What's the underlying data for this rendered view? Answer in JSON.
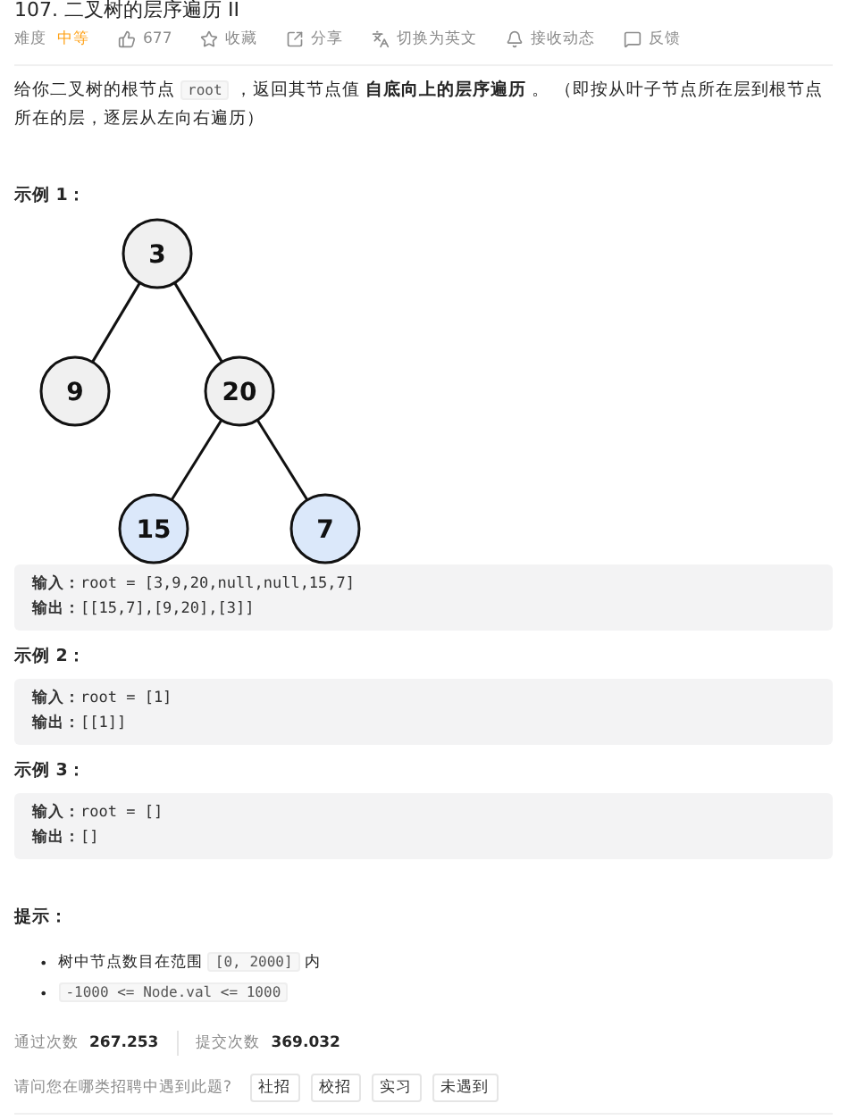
{
  "title": "107. 二叉树的层序遍历 II",
  "toolbar": {
    "difficulty_label": "难度",
    "difficulty": "中等",
    "items": [
      {
        "kind": "like",
        "label": "677"
      },
      {
        "kind": "star",
        "label": "收藏"
      },
      {
        "kind": "share",
        "label": "分享"
      },
      {
        "kind": "translate",
        "label": "切换为英文"
      },
      {
        "kind": "bell",
        "label": "接收动态"
      },
      {
        "kind": "feedback",
        "label": "反馈"
      }
    ]
  },
  "description": [
    {
      "kind": "text",
      "text": "给你二叉树的根节点 "
    },
    {
      "kind": "code",
      "text": "root"
    },
    {
      "kind": "text",
      "text": " ，返回其节点值 "
    },
    {
      "kind": "bold",
      "text": "自底向上的层序遍历"
    },
    {
      "kind": "text",
      "text": " 。 （即按从叶子节点所在层到根节点所在的层，逐层从左向右遍历）"
    }
  ],
  "examples": [
    {
      "heading": "示例 1：",
      "tree": {
        "value": "3",
        "shaded": false,
        "children": [
          {
            "value": "9",
            "shaded": false
          },
          {
            "value": "20",
            "shaded": false,
            "children": [
              {
                "value": "15",
                "shaded": true
              },
              {
                "value": "7",
                "shaded": true
              }
            ]
          }
        ]
      },
      "lines": [
        {
          "label": "输入：",
          "value": "root = [3,9,20,null,null,15,7]"
        },
        {
          "label": "输出：",
          "value": "[[15,7],[9,20],[3]]"
        }
      ]
    },
    {
      "heading": "示例 2：",
      "lines": [
        {
          "label": "输入：",
          "value": "root = [1]"
        },
        {
          "label": "输出：",
          "value": "[[1]]"
        }
      ]
    },
    {
      "heading": "示例 3：",
      "lines": [
        {
          "label": "输入：",
          "value": "root = []"
        },
        {
          "label": "输出：",
          "value": "[]"
        }
      ]
    }
  ],
  "hints": {
    "heading": "提示：",
    "items": [
      {
        "marker": "•",
        "parts": [
          {
            "kind": "text",
            "text": "树中节点数目在范围 "
          },
          {
            "kind": "code",
            "text": "[0, 2000]"
          },
          {
            "kind": "text",
            "text": " 内"
          }
        ]
      },
      {
        "marker": "•",
        "parts": [
          {
            "kind": "code",
            "text": "-1000 <= Node.val <= 1000"
          }
        ]
      }
    ]
  },
  "stats": [
    {
      "label": "通过次数",
      "value": "267.253"
    },
    {
      "label": "提交次数",
      "value": "369.032"
    }
  ],
  "recruit": {
    "question": "请问您在哪类招聘中遇到此题?",
    "options": [
      "社招",
      "校招",
      "实习",
      "未遇到"
    ]
  }
}
